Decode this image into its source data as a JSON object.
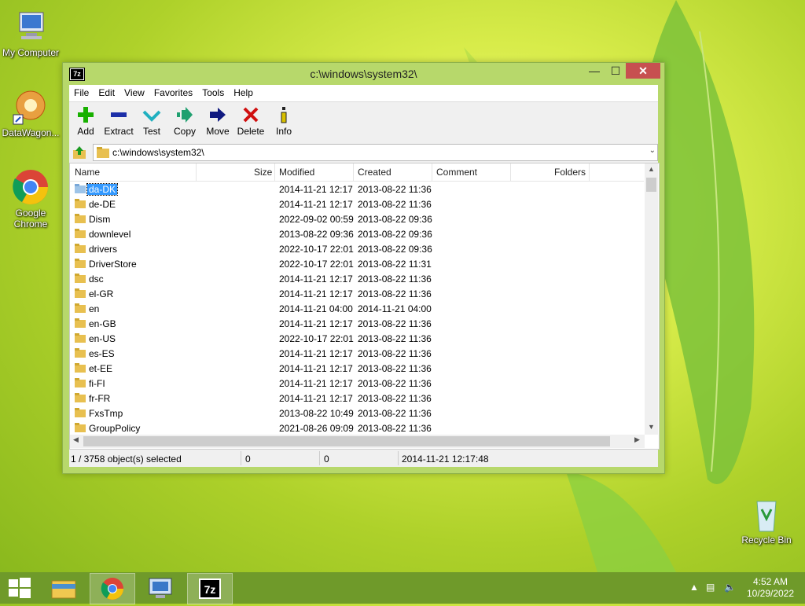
{
  "desktop": {
    "icons": [
      {
        "label": "My Computer"
      },
      {
        "label": "DataWagon..."
      },
      {
        "label": "Google Chrome"
      },
      {
        "label": "Recycle Bin"
      }
    ]
  },
  "window": {
    "title": "c:\\windows\\system32\\",
    "app_icon_text": "7z",
    "menu": [
      "File",
      "Edit",
      "View",
      "Favorites",
      "Tools",
      "Help"
    ],
    "toolbar": [
      {
        "label": "Add",
        "icon": "plus-icon",
        "color": "#18b000"
      },
      {
        "label": "Extract",
        "icon": "minus-icon",
        "color": "#1c2fa8"
      },
      {
        "label": "Test",
        "icon": "check-chevron-icon",
        "color": "#20b0c0"
      },
      {
        "label": "Copy",
        "icon": "copy-arrow-icon",
        "color": "#20a070"
      },
      {
        "label": "Move",
        "icon": "move-arrow-icon",
        "color": "#101a80"
      },
      {
        "label": "Delete",
        "icon": "x-delete-icon",
        "color": "#d01010"
      },
      {
        "label": "Info",
        "icon": "info-icon",
        "color": "#d8c000"
      }
    ],
    "address": "c:\\windows\\system32\\",
    "columns": [
      "Name",
      "Size",
      "Modified",
      "Created",
      "Comment",
      "Folders"
    ],
    "rows": [
      {
        "name": "da-DK",
        "modified": "2014-11-21 12:17",
        "created": "2013-08-22 11:36",
        "selected": true
      },
      {
        "name": "de-DE",
        "modified": "2014-11-21 12:17",
        "created": "2013-08-22 11:36"
      },
      {
        "name": "Dism",
        "modified": "2022-09-02 00:59",
        "created": "2013-08-22 09:36"
      },
      {
        "name": "downlevel",
        "modified": "2013-08-22 09:36",
        "created": "2013-08-22 09:36"
      },
      {
        "name": "drivers",
        "modified": "2022-10-17 22:01",
        "created": "2013-08-22 09:36"
      },
      {
        "name": "DriverStore",
        "modified": "2022-10-17 22:01",
        "created": "2013-08-22 11:31"
      },
      {
        "name": "dsc",
        "modified": "2014-11-21 12:17",
        "created": "2013-08-22 11:36"
      },
      {
        "name": "el-GR",
        "modified": "2014-11-21 12:17",
        "created": "2013-08-22 11:36"
      },
      {
        "name": "en",
        "modified": "2014-11-21 04:00",
        "created": "2014-11-21 04:00"
      },
      {
        "name": "en-GB",
        "modified": "2014-11-21 12:17",
        "created": "2013-08-22 11:36"
      },
      {
        "name": "en-US",
        "modified": "2022-10-17 22:01",
        "created": "2013-08-22 11:36"
      },
      {
        "name": "es-ES",
        "modified": "2014-11-21 12:17",
        "created": "2013-08-22 11:36"
      },
      {
        "name": "et-EE",
        "modified": "2014-11-21 12:17",
        "created": "2013-08-22 11:36"
      },
      {
        "name": "fi-FI",
        "modified": "2014-11-21 12:17",
        "created": "2013-08-22 11:36"
      },
      {
        "name": "fr-FR",
        "modified": "2014-11-21 12:17",
        "created": "2013-08-22 11:36"
      },
      {
        "name": "FxsTmp",
        "modified": "2013-08-22 10:49",
        "created": "2013-08-22 11:36"
      },
      {
        "name": "GroupPolicy",
        "modified": "2021-08-26 09:09",
        "created": "2013-08-22 11:36"
      }
    ],
    "status": {
      "selection": "1 / 3758 object(s) selected",
      "size": "0",
      "packed": "0",
      "modified": "2014-11-21 12:17:48"
    }
  },
  "taskbar": {
    "items": [
      "start-button",
      "file-explorer",
      "google-chrome",
      "remote-desktop",
      "7-zip"
    ],
    "time": "4:52 AM",
    "date": "10/29/2022"
  }
}
